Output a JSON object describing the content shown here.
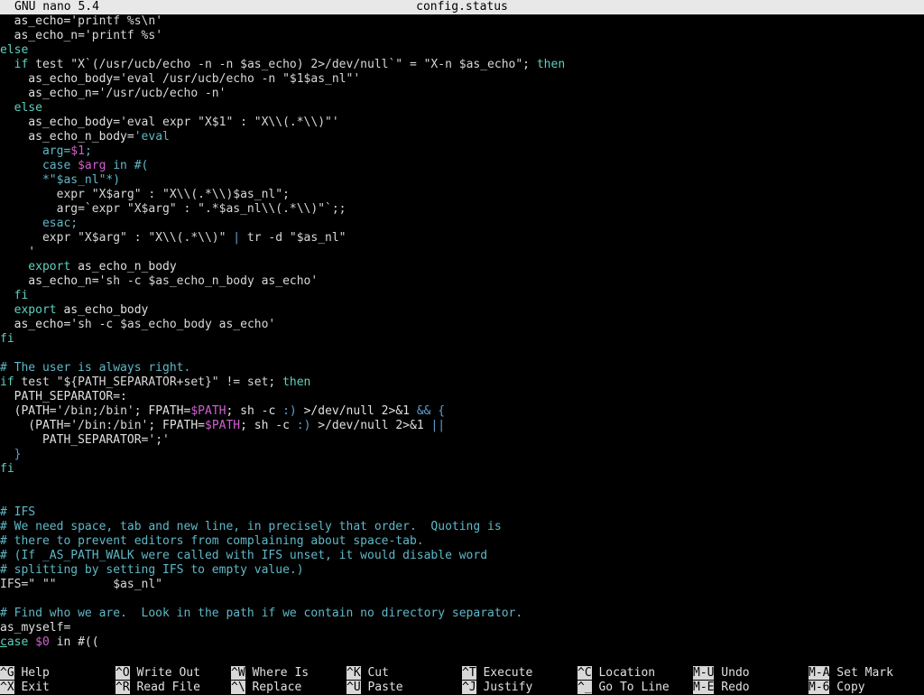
{
  "titlebar": {
    "app": "GNU nano 5.4",
    "filename": "config.status"
  },
  "editor": {
    "lines": [
      [
        {
          "t": "  as_echo=",
          "c": "tx"
        },
        {
          "t": "'printf %s\\n'",
          "c": "str"
        }
      ],
      [
        {
          "t": "  as_echo_n=",
          "c": "tx"
        },
        {
          "t": "'printf %s'",
          "c": "str"
        }
      ],
      [
        {
          "t": "else",
          "c": "kw"
        }
      ],
      [
        {
          "t": "  ",
          "c": "tx"
        },
        {
          "t": "if",
          "c": "kw"
        },
        {
          "t": " test \"X`(/usr/ucb/echo -n -n $as_echo) 2>/dev/null`\" = \"X-n $as_echo\"; ",
          "c": "str"
        },
        {
          "t": "then",
          "c": "kw"
        }
      ],
      [
        {
          "t": "    as_echo_body=",
          "c": "tx"
        },
        {
          "t": "'eval /usr/ucb/echo -n \"$1$as_nl\"'",
          "c": "str"
        }
      ],
      [
        {
          "t": "    as_echo_n=",
          "c": "tx"
        },
        {
          "t": "'/usr/ucb/echo -n'",
          "c": "str"
        }
      ],
      [
        {
          "t": "  else",
          "c": "kw"
        }
      ],
      [
        {
          "t": "    as_echo_body=",
          "c": "tx"
        },
        {
          "t": "'eval expr \"X$1\" : \"X\\\\(.*\\\\)\"'",
          "c": "str"
        }
      ],
      [
        {
          "t": "    as_echo_n_body=",
          "c": "tx"
        },
        {
          "t": "'eval",
          "c": "cm"
        }
      ],
      [
        {
          "t": "      arg=",
          "c": "cm"
        },
        {
          "t": "$1",
          "c": "var"
        },
        {
          "t": ";",
          "c": "cm"
        }
      ],
      [
        {
          "t": "      case ",
          "c": "cm"
        },
        {
          "t": "$arg",
          "c": "var"
        },
        {
          "t": " in #(",
          "c": "cm"
        }
      ],
      [
        {
          "t": "      *\"$as_nl\"*)",
          "c": "cm"
        }
      ],
      [
        {
          "t": "        expr \"X$arg\" : \"X\\\\(.*\\\\)$as_nl\";",
          "c": "str"
        }
      ],
      [
        {
          "t": "        arg=`expr \"X$arg\" : \".*$as_nl\\\\(.*\\\\)\"`;;",
          "c": "str"
        }
      ],
      [
        {
          "t": "      esac;",
          "c": "cm"
        }
      ],
      [
        {
          "t": "      expr \"X$arg\" : \"X\\\\(.*\\\\)\" ",
          "c": "str"
        },
        {
          "t": "|",
          "c": "op"
        },
        {
          "t": " tr -d \"$as_nl\"",
          "c": "str"
        }
      ],
      [
        {
          "t": "    '",
          "c": "str"
        }
      ],
      [
        {
          "t": "    export",
          "c": "kw"
        },
        {
          "t": " as_echo_n_body",
          "c": "tx"
        }
      ],
      [
        {
          "t": "    as_echo_n=",
          "c": "tx"
        },
        {
          "t": "'sh -c $as_echo_n_body as_echo'",
          "c": "str"
        }
      ],
      [
        {
          "t": "  fi",
          "c": "kw"
        }
      ],
      [
        {
          "t": "  export",
          "c": "kw"
        },
        {
          "t": " as_echo_body",
          "c": "tx"
        }
      ],
      [
        {
          "t": "  as_echo=",
          "c": "tx"
        },
        {
          "t": "'sh -c $as_echo_body as_echo'",
          "c": "str"
        }
      ],
      [
        {
          "t": "fi",
          "c": "kw"
        }
      ],
      [
        {
          "t": "",
          "c": "tx"
        }
      ],
      [
        {
          "t": "# The user is always right.",
          "c": "cm"
        }
      ],
      [
        {
          "t": "if",
          "c": "kw"
        },
        {
          "t": " test \"${PATH_SEPARATOR+set}\" != set; ",
          "c": "str"
        },
        {
          "t": "then",
          "c": "kw"
        }
      ],
      [
        {
          "t": "  PATH_SEPARATOR=:",
          "c": "tx"
        }
      ],
      [
        {
          "t": "  (PATH=",
          "c": "tx"
        },
        {
          "t": "'/bin;/bin'",
          "c": "str"
        },
        {
          "t": "; FPATH=",
          "c": "tx"
        },
        {
          "t": "$PATH",
          "c": "var"
        },
        {
          "t": "; sh -c ",
          "c": "tx"
        },
        {
          "t": ":)",
          "c": "op"
        },
        {
          "t": " >/dev/null 2>&1 ",
          "c": "tx"
        },
        {
          "t": "&& {",
          "c": "op"
        }
      ],
      [
        {
          "t": "    (PATH=",
          "c": "tx"
        },
        {
          "t": "'/bin:/bin'",
          "c": "str"
        },
        {
          "t": "; FPATH=",
          "c": "tx"
        },
        {
          "t": "$PATH",
          "c": "var"
        },
        {
          "t": "; sh -c ",
          "c": "tx"
        },
        {
          "t": ":)",
          "c": "op"
        },
        {
          "t": " >/dev/null 2>&1 ",
          "c": "tx"
        },
        {
          "t": "||",
          "c": "op"
        }
      ],
      [
        {
          "t": "      PATH_SEPARATOR=",
          "c": "tx"
        },
        {
          "t": "';'",
          "c": "str"
        }
      ],
      [
        {
          "t": "  }",
          "c": "op"
        }
      ],
      [
        {
          "t": "fi",
          "c": "kw"
        }
      ],
      [
        {
          "t": "",
          "c": "tx"
        }
      ],
      [
        {
          "t": "",
          "c": "tx"
        }
      ],
      [
        {
          "t": "# IFS",
          "c": "cm"
        }
      ],
      [
        {
          "t": "# We need space, tab and new line, in precisely that order.  Quoting is",
          "c": "cm"
        }
      ],
      [
        {
          "t": "# there to prevent editors from complaining about space-tab.",
          "c": "cm"
        }
      ],
      [
        {
          "t": "# (If _AS_PATH_WALK were called with IFS unset, it would disable word",
          "c": "cm"
        }
      ],
      [
        {
          "t": "# splitting by setting IFS to empty value.)",
          "c": "cm"
        }
      ],
      [
        {
          "t": "IFS=\" \"\"        $as_nl\"",
          "c": "str"
        }
      ],
      [
        {
          "t": "",
          "c": "tx"
        }
      ],
      [
        {
          "t": "# Find who we are.  Look in the path if we contain no directory separator.",
          "c": "cm"
        }
      ],
      [
        {
          "t": "as_myself=",
          "c": "tx"
        }
      ],
      [
        {
          "t": "c",
          "c": "kw"
        },
        {
          "t": "ase ",
          "c": "kw"
        },
        {
          "t": "$0",
          "c": "var"
        },
        {
          "t": " in #((",
          "c": "tx"
        }
      ]
    ]
  },
  "shortcuts": {
    "items": [
      {
        "key": "^G",
        "label": "Help"
      },
      {
        "key": "^X",
        "label": "Exit"
      },
      {
        "key": "^O",
        "label": "Write Out"
      },
      {
        "key": "^R",
        "label": "Read File"
      },
      {
        "key": "^W",
        "label": "Where Is"
      },
      {
        "key": "^\\",
        "label": "Replace"
      },
      {
        "key": "^K",
        "label": "Cut"
      },
      {
        "key": "^U",
        "label": "Paste"
      },
      {
        "key": "^T",
        "label": "Execute"
      },
      {
        "key": "^J",
        "label": "Justify"
      },
      {
        "key": "^C",
        "label": "Location"
      },
      {
        "key": "^_",
        "label": "Go To Line"
      },
      {
        "key": "M-U",
        "label": "Undo"
      },
      {
        "key": "M-E",
        "label": "Redo"
      },
      {
        "key": "M-A",
        "label": "Set Mark"
      },
      {
        "key": "M-6",
        "label": "Copy"
      }
    ]
  }
}
